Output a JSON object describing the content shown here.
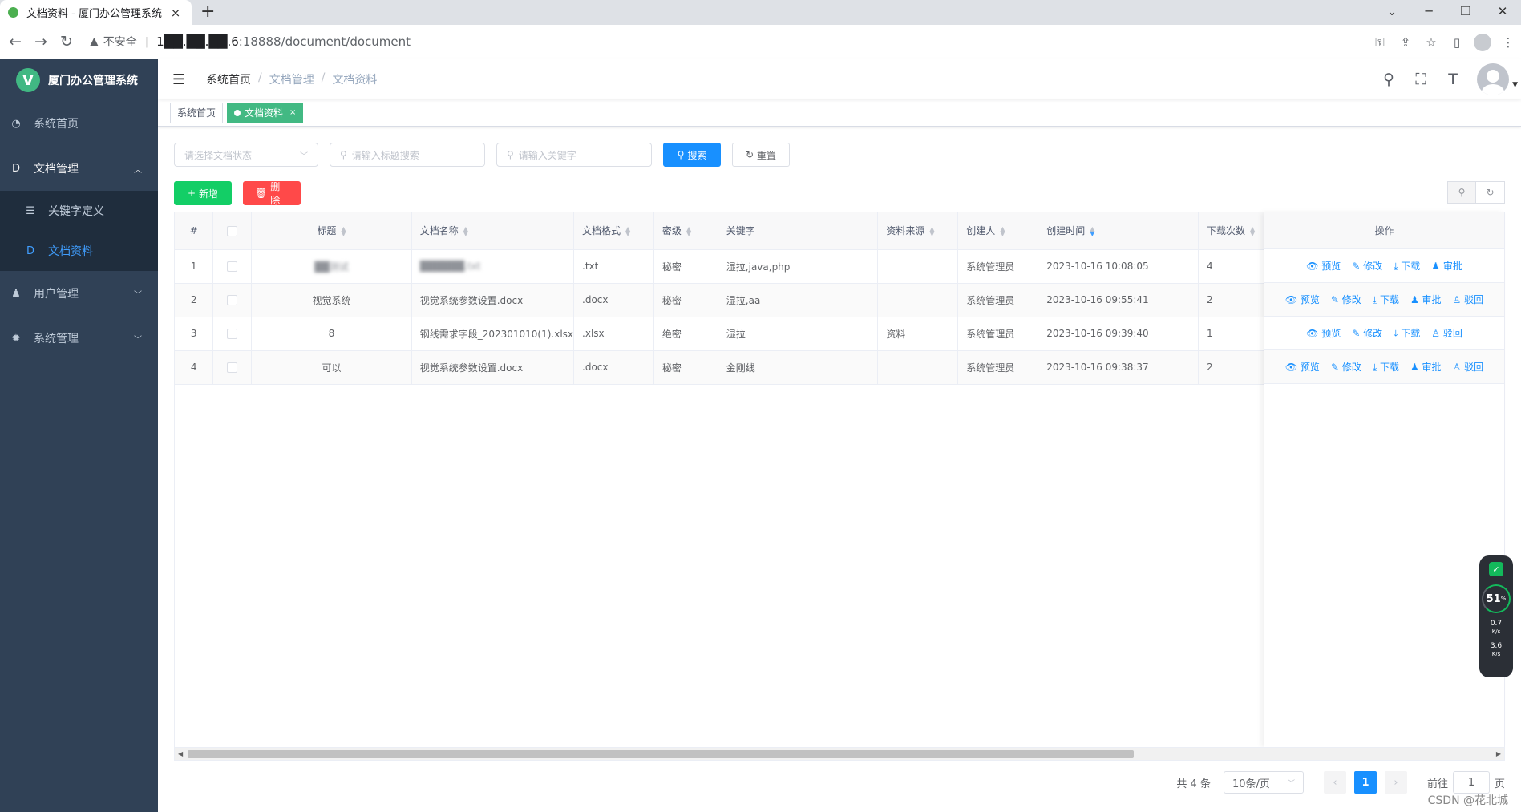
{
  "browser": {
    "tab_title": "文档资料 - 厦门办公管理系统",
    "tab_close": "×",
    "new_tab": "+",
    "insecure": "不安全",
    "url_host": "1██.██.██.6",
    "url_rest": ":18888/document/document",
    "win_min": "─",
    "win_restore": "❐",
    "win_close": "✕",
    "win_menu": "⌄"
  },
  "sidebar": {
    "logo_letter": "V",
    "app_name": "厦门办公管理系统",
    "items": [
      {
        "label": "系统首页",
        "icon": "dashboard-icon"
      },
      {
        "label": "文档管理",
        "icon": "document-icon"
      },
      {
        "label": "关键字定义",
        "icon": "list-icon"
      },
      {
        "label": "文档资料",
        "icon": "document-icon"
      },
      {
        "label": "用户管理",
        "icon": "user-icon"
      },
      {
        "label": "系统管理",
        "icon": "gear-icon"
      }
    ]
  },
  "navbar": {
    "breadcrumb": [
      "系统首页",
      "文档管理",
      "文档资料"
    ]
  },
  "tags": [
    {
      "label": "系统首页"
    },
    {
      "label": "文档资料",
      "close": "×"
    }
  ],
  "search": {
    "status_placeholder": "请选择文档状态",
    "title_placeholder": "请输入标题搜索",
    "keyword_placeholder": "请输入关键字",
    "search_label": "搜索",
    "reset_label": "重置"
  },
  "toolbar": {
    "add_label": "新增",
    "delete_label": "删除"
  },
  "table": {
    "headers": [
      "#",
      "",
      "标题",
      "文档名称",
      "文档格式",
      "密级",
      "关键字",
      "资料来源",
      "创建人",
      "创建时间",
      "下载次数",
      "操作"
    ],
    "rows": [
      {
        "idx": "1",
        "title": "██测试",
        "name": "██████.txt",
        "format": ".txt",
        "level": "秘密",
        "keywords": "湿拉,java,php",
        "source": "",
        "creator": "系统管理员",
        "time": "2023-10-16 10:08:05",
        "downloads": "4",
        "ops": [
          "预览",
          "修改",
          "下载",
          "审批"
        ]
      },
      {
        "idx": "2",
        "title": "视觉系统",
        "name": "视觉系统参数设置.docx",
        "format": ".docx",
        "level": "秘密",
        "keywords": "湿拉,aa",
        "source": "",
        "creator": "系统管理员",
        "time": "2023-10-16 09:55:41",
        "downloads": "2",
        "ops": [
          "预览",
          "修改",
          "下载",
          "审批",
          "驳回"
        ]
      },
      {
        "idx": "3",
        "title": "8",
        "name": "钢线需求字段_202301010(1).xlsx",
        "format": ".xlsx",
        "level": "绝密",
        "keywords": "湿拉",
        "source": "资料",
        "creator": "系统管理员",
        "time": "2023-10-16 09:39:40",
        "downloads": "1",
        "ops": [
          "预览",
          "修改",
          "下载",
          "驳回"
        ]
      },
      {
        "idx": "4",
        "title": "可以",
        "name": "视觉系统参数设置.docx",
        "format": ".docx",
        "level": "秘密",
        "keywords": "金刚线",
        "source": "",
        "creator": "系统管理员",
        "time": "2023-10-16 09:38:37",
        "downloads": "2",
        "ops": [
          "预览",
          "修改",
          "下载",
          "审批",
          "驳回"
        ]
      }
    ]
  },
  "pagination": {
    "total": "共 4 条",
    "page_size": "10条/页",
    "current": "1",
    "goto_prefix": "前往",
    "goto_value": "1",
    "goto_suffix": "页"
  },
  "widget": {
    "percent": "51",
    "unit": "%",
    "up": "0.7",
    "down": "3.6",
    "speed_unit": "K/s"
  },
  "watermark": "CSDN @花北城"
}
